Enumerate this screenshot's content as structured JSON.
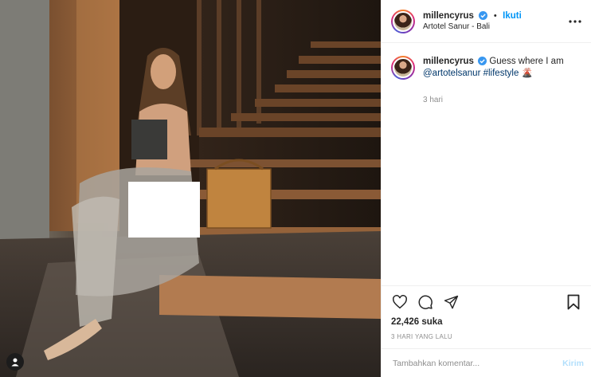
{
  "post": {
    "username": "millencyrus",
    "follow_label": "Ikuti",
    "location": "Artotel Sanur - Bali",
    "caption_text": "Guess where I am",
    "caption_mention": "@artotelsanur",
    "caption_hashtag": "#lifestyle",
    "caption_emoji": "🌋",
    "comment_time": "3 hari",
    "likes": "22,426 suka",
    "posted_ago": "3 HARI YANG LALU",
    "comment_placeholder": "Tambahkan komentar...",
    "send_label": "Kirim"
  },
  "colors": {
    "accent": "#0095f6",
    "verified": "#3897f0",
    "send_disabled": "#b2dffc",
    "muted": "#8e8e8e"
  },
  "icons": [
    "verified-icon",
    "more-options-icon",
    "heart-icon",
    "comment-icon",
    "share-icon",
    "bookmark-icon",
    "user-tag-icon"
  ]
}
